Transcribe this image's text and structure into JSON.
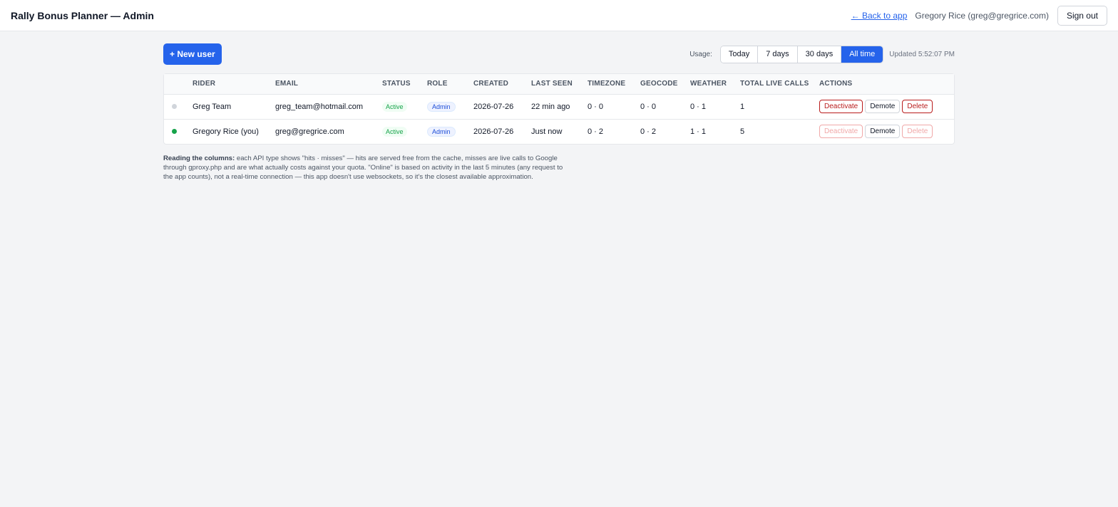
{
  "header": {
    "title": "Rally Bonus Planner — Admin",
    "back_link": "← Back to app",
    "user": "Gregory Rice (greg@gregrice.com)",
    "signout": "Sign out"
  },
  "toolbar": {
    "new_user": "+ New user",
    "usage_label": "Usage:",
    "ranges": [
      "Today",
      "7 days",
      "30 days",
      "All time"
    ],
    "selected_range": "All time",
    "updated": "Updated 5:52:07 PM"
  },
  "table": {
    "columns": [
      "",
      "Rider",
      "Email",
      "Status",
      "Role",
      "Created",
      "Last seen",
      "Timezone",
      "Geocode",
      "Weather",
      "Total live calls",
      "Actions"
    ],
    "rows": [
      {
        "online": false,
        "rider": "Greg Team",
        "email": "greg_team@hotmail.com",
        "status": "Active",
        "role": "Admin",
        "created": "2026-07-26",
        "last_seen": "22 min ago",
        "timezone": "0 · 0",
        "geocode": "0 · 0",
        "weather": "0 · 1",
        "total_live_calls": "1",
        "actions": [
          "Deactivate",
          "Demote",
          "Delete"
        ]
      },
      {
        "online": true,
        "rider": "Gregory Rice (you)",
        "email": "greg@gregrice.com",
        "status": "Active",
        "role": "Admin",
        "created": "2026-07-26",
        "last_seen": "Just now",
        "timezone": "0 · 2",
        "geocode": "0 · 2",
        "weather": "1 · 1",
        "total_live_calls": "5",
        "actions": [
          "Deactivate",
          "Demote",
          "Delete"
        ]
      }
    ]
  },
  "note": {
    "lead": "Reading the columns:",
    "body": " each API type shows \"hits · misses\" — hits are served free from the cache, misses are live calls to Google through gproxy.php and are what actually costs against your quota. \"Online\" is based on activity in the last 5 minutes (any request to the app counts), not a real-time connection — this app doesn't use websockets, so it's the closest available approximation."
  },
  "colors": {
    "accent": "#2563eb",
    "online": "#16a34a",
    "offline": "#d1d5db",
    "danger": "#b91c1c"
  }
}
